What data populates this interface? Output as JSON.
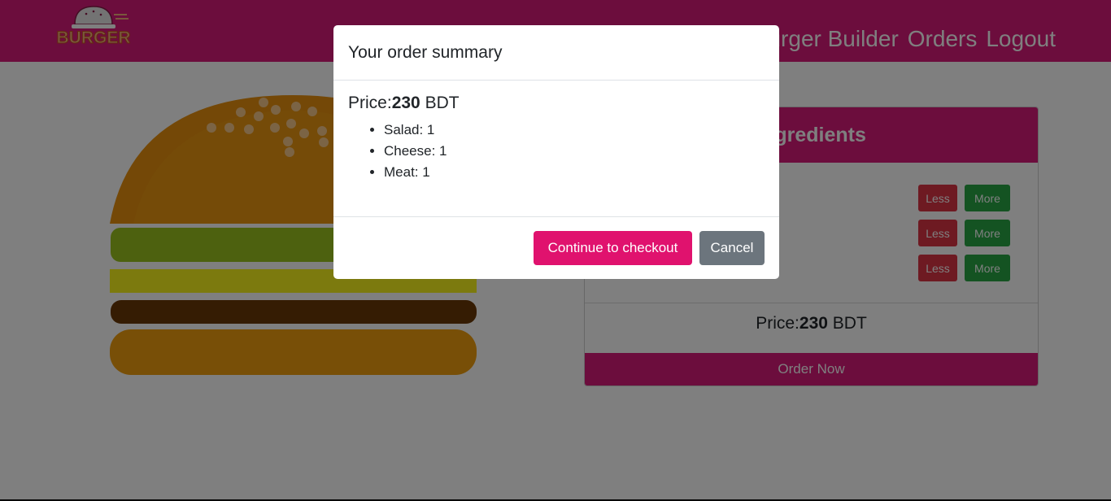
{
  "navbar": {
    "logo_text": "BURGER",
    "links": [
      "Burger Builder",
      "Orders",
      "Logout"
    ]
  },
  "controls": {
    "title": "Ingredients",
    "rows": [
      {
        "less": "Less",
        "more": "More"
      },
      {
        "less": "Less",
        "more": "More"
      },
      {
        "less": "Less",
        "more": "More"
      }
    ],
    "price_label": "Price:",
    "price_value": "230",
    "currency": "BDT",
    "order_button": "Order Now"
  },
  "modal": {
    "title": "Your order summary",
    "price_label": "Price:",
    "price_value": "230",
    "currency": "BDT",
    "items": [
      "Salad: 1",
      "Cheese: 1",
      "Meat: 1"
    ],
    "checkout_button": "Continue to checkout",
    "cancel_button": "Cancel"
  },
  "colors": {
    "brand": "#d81b7b",
    "checkout": "#e0126e",
    "less": "#dc3545",
    "more": "#28a745",
    "cancel": "#6c757d"
  }
}
